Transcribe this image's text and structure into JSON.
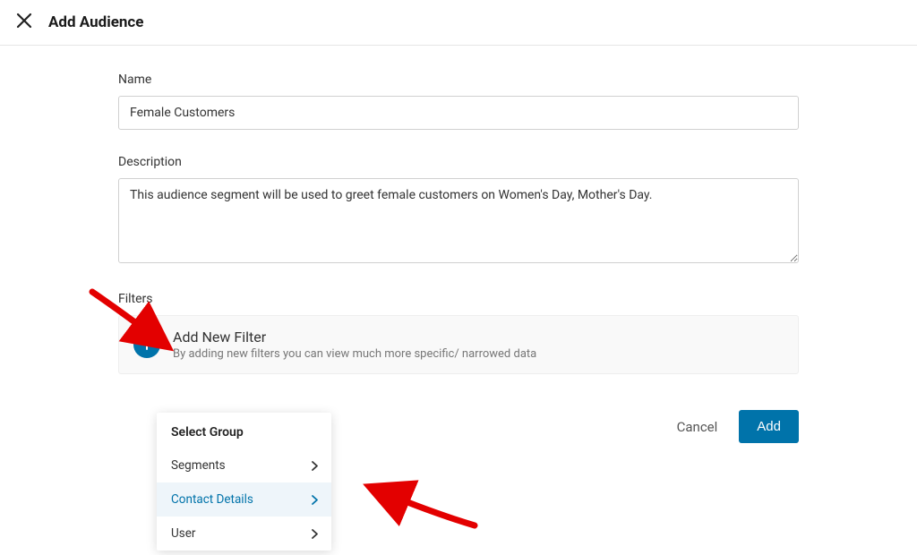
{
  "header": {
    "title": "Add Audience"
  },
  "form": {
    "name_label": "Name",
    "name_value": "Female Customers",
    "description_label": "Description",
    "description_value": "This audience segment will be used to greet female customers on Women's Day, Mother's Day.",
    "filters_label": "Filters",
    "add_filter_title": "Add New Filter",
    "add_filter_subtitle": "By adding new filters you can view much more specific/ narrowed data"
  },
  "actions": {
    "cancel_label": "Cancel",
    "add_label": "Add"
  },
  "dropdown": {
    "title": "Select Group",
    "items": [
      {
        "label": "Segments",
        "active": false
      },
      {
        "label": "Contact Details",
        "active": true
      },
      {
        "label": "User",
        "active": false
      }
    ]
  }
}
